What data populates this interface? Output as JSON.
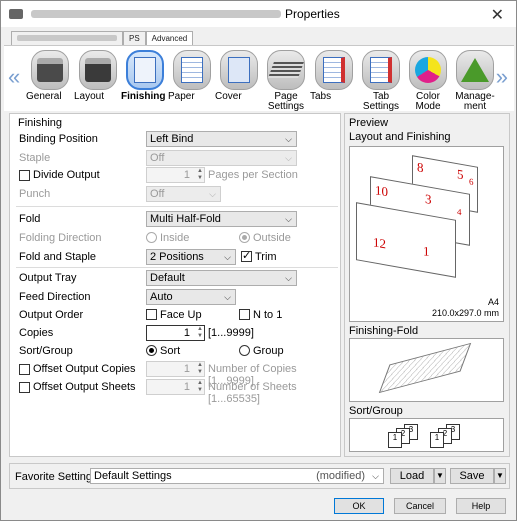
{
  "window": {
    "title": "Properties",
    "close_glyph": "✕"
  },
  "top_tabs": [
    {
      "label": "PS"
    },
    {
      "label": "Advanced"
    }
  ],
  "ribbon": {
    "items": [
      {
        "label": "General",
        "icon": "general-icon"
      },
      {
        "label": "Layout",
        "icon": "layout-icon"
      },
      {
        "label": "Finishing",
        "icon": "finishing-icon",
        "selected": true
      },
      {
        "label": "Paper",
        "icon": "paper-icon"
      },
      {
        "label": "Cover",
        "icon": "cover-icon"
      },
      {
        "label": "Page Settings",
        "icon": "page-settings-icon"
      },
      {
        "label": "Tabs",
        "icon": "tabs-icon"
      },
      {
        "label": "Tab Settings",
        "icon": "tab-settings-icon"
      },
      {
        "label": "Color Mode",
        "icon": "color-mode-icon"
      },
      {
        "label": "Manage-ment",
        "icon": "management-icon"
      }
    ],
    "left_arrow": "«",
    "right_arrow": "»"
  },
  "finishing": {
    "group_label": "Finishing",
    "binding_position": {
      "label": "Binding Position",
      "value": "Left Bind"
    },
    "staple": {
      "label": "Staple",
      "value": "Off"
    },
    "divide_output": {
      "label": "Divide Output",
      "value": "1",
      "unit": "Pages per Section"
    },
    "punch": {
      "label": "Punch",
      "value": "Off"
    },
    "fold": {
      "label": "Fold",
      "value": "Multi Half-Fold"
    },
    "folding_direction": {
      "label": "Folding Direction",
      "inside": "Inside",
      "outside": "Outside"
    },
    "fold_and_staple": {
      "label": "Fold and Staple",
      "value": "2 Positions",
      "trim": "Trim"
    },
    "output_tray": {
      "label": "Output Tray",
      "value": "Default"
    },
    "feed_direction": {
      "label": "Feed Direction",
      "value": "Auto"
    },
    "output_order": {
      "label": "Output Order",
      "face_up": "Face Up",
      "n_to_1": "N to 1"
    },
    "copies": {
      "label": "Copies",
      "value": "1",
      "range": "[1...9999]"
    },
    "sort_group": {
      "label": "Sort/Group",
      "sort": "Sort",
      "group": "Group"
    },
    "offset_output_copies": {
      "label": "Offset Output Copies",
      "value": "1",
      "unit": "Number of Copies [1...9999]"
    },
    "offset_output_sheets": {
      "label": "Offset Output Sheets",
      "value": "1",
      "unit": "Number of Sheets [1...65535]"
    }
  },
  "preview": {
    "group_label": "Preview",
    "layout_label": "Layout and Finishing",
    "paper_size": "A4",
    "paper_dims": "210.0x297.0 mm",
    "finishing_fold_label": "Finishing-Fold",
    "sort_group_label": "Sort/Group",
    "page_numbers": [
      "8",
      "5",
      "6",
      "10",
      "3",
      "4",
      "12",
      "1"
    ],
    "sort_pages": [
      "1",
      "2",
      "3",
      "1",
      "2",
      "3"
    ]
  },
  "favorite": {
    "label": "Favorite Setting",
    "value": "Default Settings",
    "modified": "(modified)",
    "load": "Load",
    "save": "Save"
  },
  "buttons": {
    "ok": "OK",
    "cancel": "Cancel",
    "help": "Help"
  }
}
